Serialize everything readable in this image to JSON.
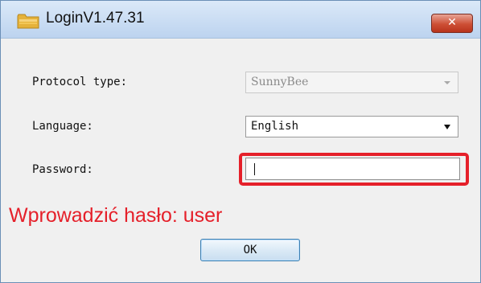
{
  "window": {
    "title": "LoginV1.47.31",
    "close_label": "✕"
  },
  "form": {
    "protocol_type": {
      "label": "Protocol type:",
      "value": "SunnyBee"
    },
    "language": {
      "label": "Language:",
      "value": "English"
    },
    "password": {
      "label": "Password:",
      "value": ""
    }
  },
  "instruction": "Wprowadzić hasło: user",
  "ok_button": {
    "label": "OK"
  },
  "colors": {
    "highlight": "#e5202a",
    "titlebar": "#bcd3ef",
    "close_button": "#cd4f35"
  },
  "icons": {
    "app": "folder-icon",
    "close": "close-icon",
    "dropdown": "chevron-down-icon"
  }
}
